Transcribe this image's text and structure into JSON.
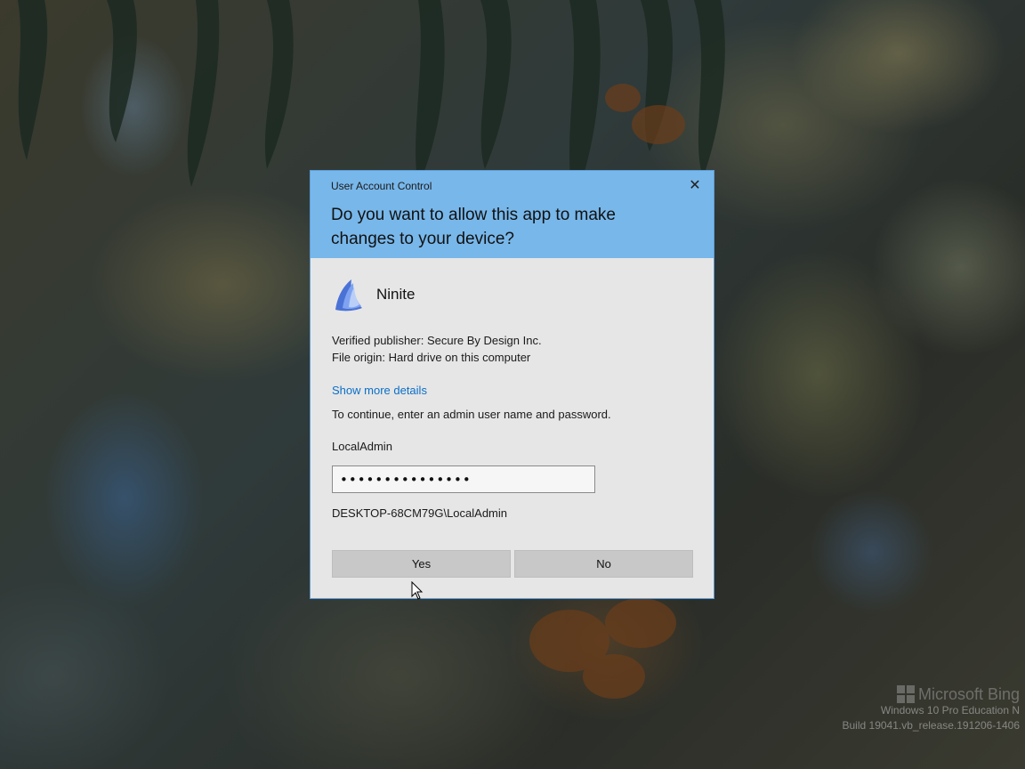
{
  "dialog": {
    "caption": "User Account Control",
    "question": "Do you want to allow this app to make changes to your device?",
    "app_name": "Ninite",
    "publisher": "Verified publisher: Secure By Design Inc.",
    "file_origin": "File origin: Hard drive on this computer",
    "details_link": "Show more details",
    "continue_text": "To continue, enter an admin user name and password.",
    "username": "LocalAdmin",
    "password_value": "•••••••••••••••",
    "domain_user": "DESKTOP-68CM79G\\LocalAdmin",
    "yes_label": "Yes",
    "no_label": "No",
    "close_glyph": "✕",
    "icons": [
      "ninite-icon",
      "close-icon",
      "mouse-cursor-icon"
    ]
  },
  "branding": {
    "logo_text": "Microsoft Bing",
    "edition": "Windows 10 Pro Education N",
    "build": "Build 19041.vb_release.191206-1406"
  },
  "colors": {
    "header": "#78b7ea",
    "body": "#e6e6e6",
    "link": "#0b6fc9",
    "button": "#c8c8c8"
  }
}
